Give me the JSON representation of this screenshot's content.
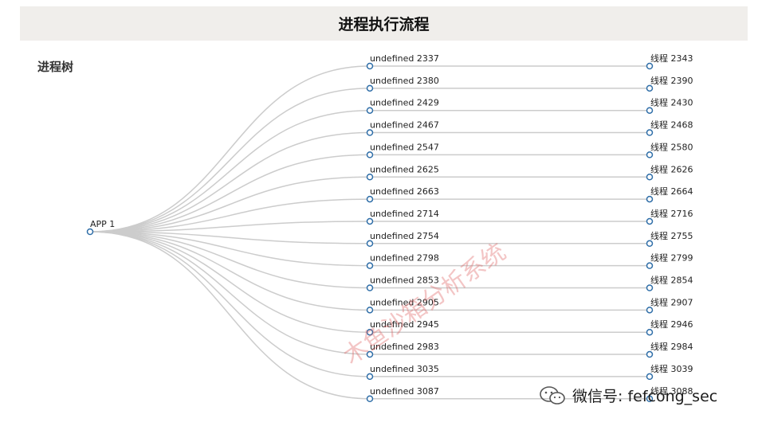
{
  "header": {
    "title": "进程执行流程"
  },
  "section": {
    "label": "进程树"
  },
  "tree": {
    "root": "APP 1",
    "children": [
      {
        "label": "undefined 2337",
        "thread": "线程 2343"
      },
      {
        "label": "undefined 2380",
        "thread": "线程 2390"
      },
      {
        "label": "undefined 2429",
        "thread": "线程 2430"
      },
      {
        "label": "undefined 2467",
        "thread": "线程 2468"
      },
      {
        "label": "undefined 2547",
        "thread": "线程 2580"
      },
      {
        "label": "undefined 2625",
        "thread": "线程 2626"
      },
      {
        "label": "undefined 2663",
        "thread": "线程 2664"
      },
      {
        "label": "undefined 2714",
        "thread": "线程 2716"
      },
      {
        "label": "undefined 2754",
        "thread": "线程 2755"
      },
      {
        "label": "undefined 2798",
        "thread": "线程 2799"
      },
      {
        "label": "undefined 2853",
        "thread": "线程 2854"
      },
      {
        "label": "undefined 2905",
        "thread": "线程 2907"
      },
      {
        "label": "undefined 2945",
        "thread": "线程 2946"
      },
      {
        "label": "undefined 2983",
        "thread": "线程 2984"
      },
      {
        "label": "undefined 3035",
        "thread": "线程 3039"
      },
      {
        "label": "undefined 3087",
        "thread": "线程 3088"
      }
    ]
  },
  "colors": {
    "link": "#cccccc",
    "node_stroke": "#2f6ea8",
    "node_fill": "#ffffff"
  },
  "watermark": {
    "text": "木鱼沙箱分析系统"
  },
  "footer": {
    "wechat_text": "微信号: fefcong_sec",
    "icon": "wechat-icon"
  }
}
